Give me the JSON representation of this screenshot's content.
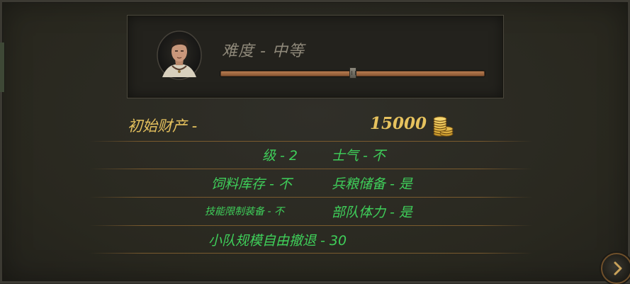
{
  "difficulty": {
    "label": "难度 - 中等",
    "level": 0.5
  },
  "starting_wealth": {
    "label": "初始财产 -",
    "value": "15000",
    "icon": "gold-coins-icon"
  },
  "options": {
    "level": "级 - 2",
    "morale": "士气 - 不",
    "forage_stock": "饲料库存 - 不",
    "rations": "兵粮储备 - 是",
    "skill_equip_limit": "技能限制装备 - 不",
    "stamina": "部队体力 - 是",
    "squad_retreat": "小队规模自由撤退 - 30"
  },
  "colors": {
    "gold_text": "#e6c25e",
    "green_text": "#3fcf5a",
    "muted_text": "#8f897a",
    "slider_track": "#b77c50"
  },
  "next_button": {
    "icon": "chevron-right-icon"
  }
}
